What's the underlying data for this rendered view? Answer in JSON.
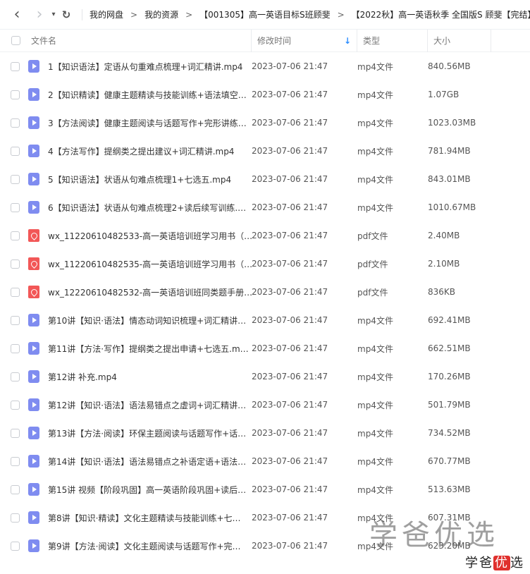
{
  "nav": {
    "back_glyph": "‹",
    "forward_glyph": "›",
    "dropdown_glyph": "▾",
    "refresh_glyph": "↻",
    "crumb_sep": ">",
    "breadcrumbs": [
      "我的网盘",
      "我的资源",
      "【001305】高一英语目标S班顾斐",
      "【2022秋】高一英语秋季 全国版S 顾斐【完结】"
    ]
  },
  "header": {
    "name": "文件名",
    "time": "修改时间",
    "sort_glyph": "↓",
    "type": "类型",
    "size": "大小"
  },
  "files": [
    {
      "icon": "video-file-icon",
      "name": "1【知识语法】定语从句重难点梳理+词汇精讲.mp4",
      "time": "2023-07-06 21:47",
      "type": "mp4文件",
      "size": "840.56MB"
    },
    {
      "icon": "video-file-icon",
      "name": "2【知识精读】健康主题精读与技能训练+语法填空…",
      "time": "2023-07-06 21:47",
      "type": "mp4文件",
      "size": "1.07GB"
    },
    {
      "icon": "video-file-icon",
      "name": "3【方法阅读】健康主题阅读与话题写作+完形讲练…",
      "time": "2023-07-06 21:47",
      "type": "mp4文件",
      "size": "1023.03MB"
    },
    {
      "icon": "video-file-icon",
      "name": "4【方法写作】提纲类之提出建议+词汇精讲.mp4",
      "time": "2023-07-06 21:47",
      "type": "mp4文件",
      "size": "781.94MB"
    },
    {
      "icon": "video-file-icon",
      "name": "5【知识语法】状语从句难点梳理1+七选五.mp4",
      "time": "2023-07-06 21:47",
      "type": "mp4文件",
      "size": "843.01MB"
    },
    {
      "icon": "video-file-icon",
      "name": "6【知识语法】状语从句难点梳理2+读后续写训练.…",
      "time": "2023-07-06 21:47",
      "type": "mp4文件",
      "size": "1010.67MB"
    },
    {
      "icon": "pdf-file-icon",
      "name": "wx_11220610482533-高一英语培训班学习用书（…",
      "time": "2023-07-06 21:47",
      "type": "pdf文件",
      "size": "2.40MB"
    },
    {
      "icon": "pdf-file-icon",
      "name": "wx_11220610482535-高一英语培训班学习用书（…",
      "time": "2023-07-06 21:47",
      "type": "pdf文件",
      "size": "2.10MB"
    },
    {
      "icon": "pdf-file-icon",
      "name": "wx_12220610482532-高一英语培训班同类题手册…",
      "time": "2023-07-06 21:47",
      "type": "pdf文件",
      "size": "836KB"
    },
    {
      "icon": "video-file-icon",
      "name": "第10讲【知识·语法】情态动词知识梳理+词汇精讲…",
      "time": "2023-07-06 21:47",
      "type": "mp4文件",
      "size": "692.41MB"
    },
    {
      "icon": "video-file-icon",
      "name": "第11讲【方法·写作】提纲类之提出申请+七选五.m…",
      "time": "2023-07-06 21:47",
      "type": "mp4文件",
      "size": "662.51MB"
    },
    {
      "icon": "video-file-icon",
      "name": "第12讲 补充.mp4",
      "time": "2023-07-06 21:47",
      "type": "mp4文件",
      "size": "170.26MB"
    },
    {
      "icon": "video-file-icon",
      "name": "第12讲【知识·语法】语法易错点之虚词+词汇精讲…",
      "time": "2023-07-06 21:47",
      "type": "mp4文件",
      "size": "501.79MB"
    },
    {
      "icon": "video-file-icon",
      "name": "第13讲【方法·阅读】环保主题阅读与话题写作+话…",
      "time": "2023-07-06 21:47",
      "type": "mp4文件",
      "size": "734.52MB"
    },
    {
      "icon": "video-file-icon",
      "name": "第14讲【知识·语法】语法易错点之补语定语+语法…",
      "time": "2023-07-06 21:47",
      "type": "mp4文件",
      "size": "670.77MB"
    },
    {
      "icon": "video-file-icon",
      "name": "第15讲 视频【阶段巩固】高一英语阶段巩固+读后…",
      "time": "2023-07-06 21:47",
      "type": "mp4文件",
      "size": "513.63MB"
    },
    {
      "icon": "video-file-icon",
      "name": "第8讲【知识·精读】文化主题精读与技能训练+七…",
      "time": "2023-07-06 21:47",
      "type": "mp4文件",
      "size": "607.31MB"
    },
    {
      "icon": "video-file-icon",
      "name": "第9讲【方法·阅读】文化主题阅读与话题写作+完…",
      "time": "2023-07-06 21:47",
      "type": "mp4文件",
      "size": "623.20MB"
    }
  ],
  "watermark": {
    "big": "学爸优选",
    "small_a": "学爸",
    "small_b": "优",
    "small_c": "选"
  }
}
